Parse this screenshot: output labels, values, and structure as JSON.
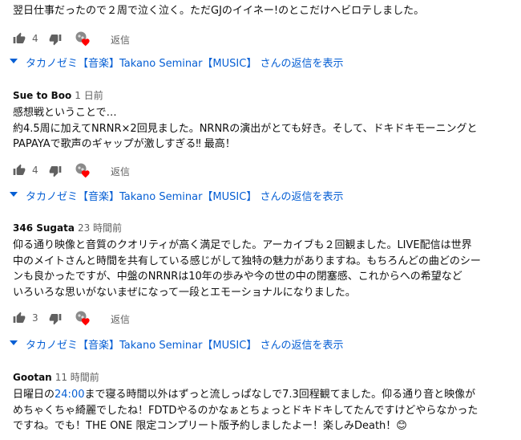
{
  "comments": [
    {
      "author": "",
      "time": "",
      "lines": [
        "翌日仕事だったので２周で泣く泣く。ただGJのイイネー!のとこだけへビロテしました。"
      ],
      "likes": "4",
      "reply_label": "返信",
      "replies_label": "タカノゼミ【音楽】Takano Seminar【MUSIC】 さんの返信を表示"
    },
    {
      "author": "Sue to Boo",
      "time": "1 日前",
      "lines": [
        "感想戦ということで…",
        "約4.5周に加えてNRNR×2回見ました。NRNRの演出がとても好き。そして、ドキドキモーニングと",
        "PAPAYAで歌声のギャップが激しすぎる‼ 最高！"
      ],
      "likes": "4",
      "reply_label": "返信",
      "replies_label": "タカノゼミ【音楽】Takano Seminar【MUSIC】 さんの返信を表示"
    },
    {
      "author": "346 Sugata",
      "time": "23 時間前",
      "lines": [
        "仰る通り映像と音質のクオリティが高く満足でした。アーカイブも２回観ました。LIVE配信は世界",
        "中のメイトさんと時間を共有している感じがして独特の魅力がありますね。もちろんどの曲どのシー",
        "ンも良かったですが、中盤のNRNRは10年の歩みや今の世の中の閉塞感、これからへの希望など",
        "いろいろな思いがないまぜになって一段とエモーショナルになりました。"
      ],
      "likes": "3",
      "reply_label": "返信",
      "replies_label": "タカノゼミ【音楽】Takano Seminar【MUSIC】 さんの返信を表示"
    },
    {
      "author": "Gootan",
      "time": "11 時間前",
      "line1_prefix": "日曜日の",
      "line1_timestamp": "24:00",
      "line1_suffix": "まで寝る時間以外はずっと流しっぱなしで7.3回程観てました。仰る通り音と映像が",
      "lines": [
        "めちゃくちゃ綺麗でしたね！FDTDやるのかなぁとちょっとドキドキしてたんですけどやらなかった",
        "ですね。でも！THE ONE 限定コンプリート版予約しましたよー！楽しみDeath！😊"
      ]
    }
  ],
  "colors": {
    "link": "#065fd4",
    "secondary": "#606060",
    "heart": "#ff0000"
  },
  "icons": [
    "thumb-up-icon",
    "thumb-down-icon",
    "creator-heart-icon",
    "chevron-down-icon"
  ]
}
